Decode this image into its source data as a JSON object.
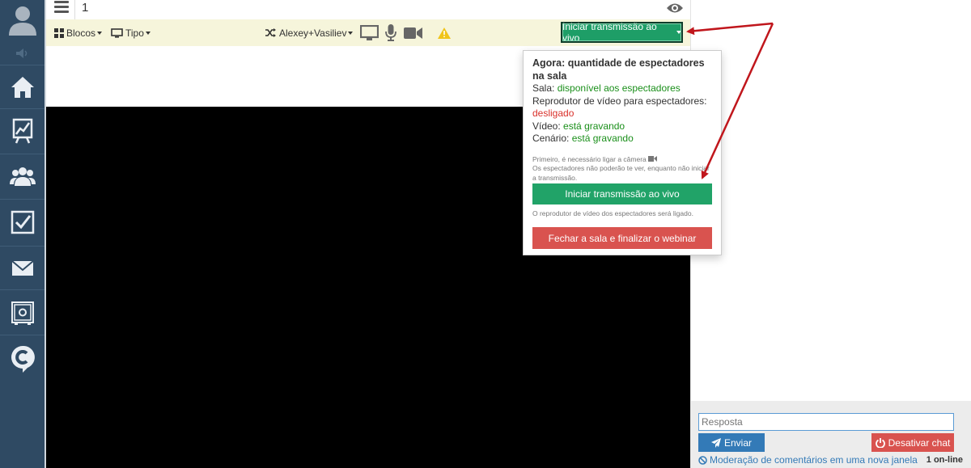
{
  "topbar": {
    "room_number": "1"
  },
  "toolbar": {
    "blocks_label": "Blocos",
    "type_label": "Tipo",
    "presenters_label": "Alexey+Vasiliev",
    "live_button_label": "Iniciar transmissão ao vivo"
  },
  "popup": {
    "title": "Agora: quantidade de espectadores na sala",
    "room_label": "Sala:",
    "room_value": "disponível aos espectadores",
    "player_label": "Reprodutor de vídeo para espectadores:",
    "player_value": "desligado",
    "video_label": "Vídeo:",
    "video_value": "está gravando",
    "scene_label": "Cenário:",
    "scene_value": "está gravando",
    "note_line1": "Primeiro, é necessário ligar a câmera",
    "note_line2": "Os espectadores não poderão te ver, enquanto não iniciar a transmissão.",
    "live_button": "Iniciar transmissão ao vivo",
    "player_note": "O reprodutor de vídeo dos espectadores será ligado.",
    "close_button": "Fechar a sala e finalizar o webinar"
  },
  "chat": {
    "reply_placeholder": "Resposta",
    "send_label": "Enviar",
    "disable_label": "Desativar chat",
    "moderation_link": "Moderação de comentários em uma nova janela",
    "online_count": "1 on-line"
  },
  "icons": {
    "sidebar": [
      "user-avatar-icon",
      "volume-icon",
      "home-icon",
      "chart-board-icon",
      "users-group-icon",
      "checkbox-icon",
      "mail-icon",
      "safe-icon",
      "chat-c-icon"
    ],
    "toolbar": [
      "grid-icon",
      "monitor-icon",
      "shuffle-icon",
      "screen-icon",
      "microphone-icon",
      "video-camera-icon",
      "warning-icon"
    ]
  },
  "colors": {
    "sidebar_bg": "#2f4a63",
    "toolbar_bg": "#f6f5db",
    "live_green": "#1e9e67",
    "danger_red": "#d9534f",
    "primary_blue": "#337ab7",
    "annotation_arrow": "#c0161c"
  }
}
